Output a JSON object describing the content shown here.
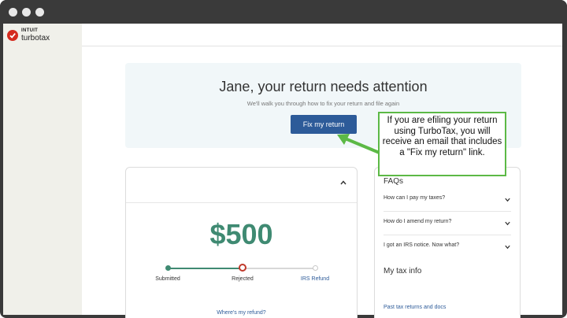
{
  "brand": {
    "intuit": "INTUIT",
    "turbotax": "turbotax",
    "color": "#d52b1e"
  },
  "banner": {
    "title": "Jane, your return needs attention",
    "subtitle": "We'll walk you through how to fix your return and file again",
    "button_label": "Fix my return",
    "button_color": "#2d5b99"
  },
  "refund_card": {
    "amount": "$500",
    "amount_color": "#3f8a72",
    "steps": [
      {
        "label": "Submitted",
        "state": "done"
      },
      {
        "label": "Rejected",
        "state": "error"
      },
      {
        "label": "IRS Refund",
        "state": "pending"
      }
    ],
    "link": "Where's my refund?"
  },
  "faqs": {
    "title": "FAQs",
    "items": [
      {
        "question": "How can I pay my taxes?"
      },
      {
        "question": "How do I amend my return?"
      },
      {
        "question": "I got an IRS notice. Now what?"
      }
    ]
  },
  "tax_info": {
    "title": "My tax info",
    "link": "Past tax returns and docs"
  },
  "callout": {
    "text": "If you are efiling your return using TurboTax, you will receive an email that includes a \"Fix my return\" link.",
    "border_color": "#5cb946"
  }
}
